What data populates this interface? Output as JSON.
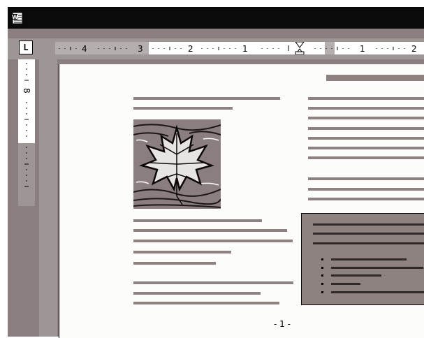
{
  "app": {
    "icon": "word-document-icon"
  },
  "toolbar": {
    "tab_selector_label": "L"
  },
  "ruler": {
    "horizontal_numbers": [
      "4",
      "3",
      "2",
      "1",
      "1",
      "2"
    ],
    "vertical_numbers": [
      "8"
    ]
  },
  "page": {
    "page_number": "- 1 -"
  },
  "colors": {
    "frame": "#8a7f7e",
    "bar": "#8e8281",
    "title": "#0a0a0a"
  }
}
